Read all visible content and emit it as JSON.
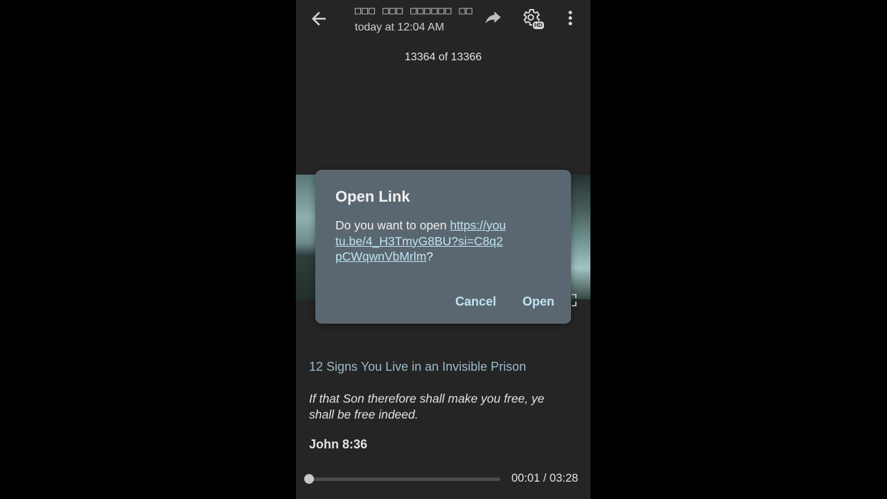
{
  "header": {
    "title": "□□□ □□□ □□□□□□ □□",
    "subtitle": "today at 12:04 AM",
    "icons": {
      "back": "arrow-left",
      "share": "share-arrow",
      "settings": "gear-with-hd-badge",
      "more": "vertical-ellipsis"
    },
    "hd_badge": "HD"
  },
  "counter": "13364 of 13366",
  "dialog": {
    "title": "Open Link",
    "prompt": "Do you want to open ",
    "url": "https://youtu.be/4_H3TmyG8BU?si=C8q2pCWqwnVbMrlm",
    "suffix": "?",
    "cancel_label": "Cancel",
    "open_label": "Open"
  },
  "caption": {
    "title": "12 Signs You Live in an Invisible Prison",
    "quote": "If that Son therefore shall make you free, ye shall be free indeed.",
    "reference": "John 8:36"
  },
  "player": {
    "current_time": "00:01",
    "duration": "03:28",
    "time_display": "00:01 / 03:28",
    "progress_fraction": 0.005
  },
  "colors": {
    "background": "#252525",
    "dialog_bg": "#5b6770",
    "link": "#bfe3f4",
    "caption_title": "#9bbacb"
  }
}
